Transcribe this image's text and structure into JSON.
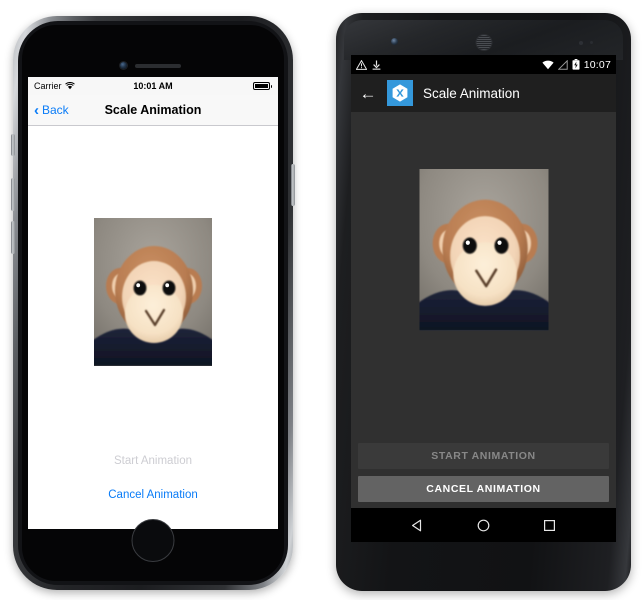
{
  "page": {
    "title": "Scale Animation - iOS and Android comparison"
  },
  "ios": {
    "device_name": "iPhone",
    "status_bar": {
      "carrier": "Carrier",
      "wifi_icon": "wifi-icon",
      "time": "10:01 AM",
      "battery_icon": "battery-full-icon"
    },
    "nav_bar": {
      "back_icon": "chevron-left-icon",
      "back_label": "Back",
      "title": "Scale Animation"
    },
    "content": {
      "image_name": "monkey-photo"
    },
    "buttons": {
      "start": {
        "label": "Start Animation",
        "enabled": false,
        "color": "#cdcdd2"
      },
      "cancel": {
        "label": "Cancel Animation",
        "enabled": true,
        "color": "#0a7cf7"
      }
    }
  },
  "android": {
    "device_name": "Android",
    "status_bar": {
      "warning_icon": "warning-triangle-icon",
      "download_icon": "download-icon",
      "wifi_icon": "wifi-icon",
      "signal_icon": "no-signal-icon",
      "battery_icon": "battery-charging-icon",
      "time": "10:07"
    },
    "action_bar": {
      "back_icon": "arrow-left-icon",
      "app_icon": "xamarin-logo-icon",
      "title": "Scale Animation",
      "accent_color": "#3498db"
    },
    "content": {
      "image_name": "monkey-photo"
    },
    "buttons": {
      "start": {
        "label": "START ANIMATION",
        "enabled": false,
        "bg": "#3a3a3a",
        "color": "#888888"
      },
      "cancel": {
        "label": "CANCEL ANIMATION",
        "enabled": true,
        "bg": "#636363",
        "color": "#ffffff"
      }
    },
    "nav_bar": {
      "back_icon": "triangle-back-icon",
      "home_icon": "circle-home-icon",
      "recents_icon": "square-recents-icon"
    }
  }
}
